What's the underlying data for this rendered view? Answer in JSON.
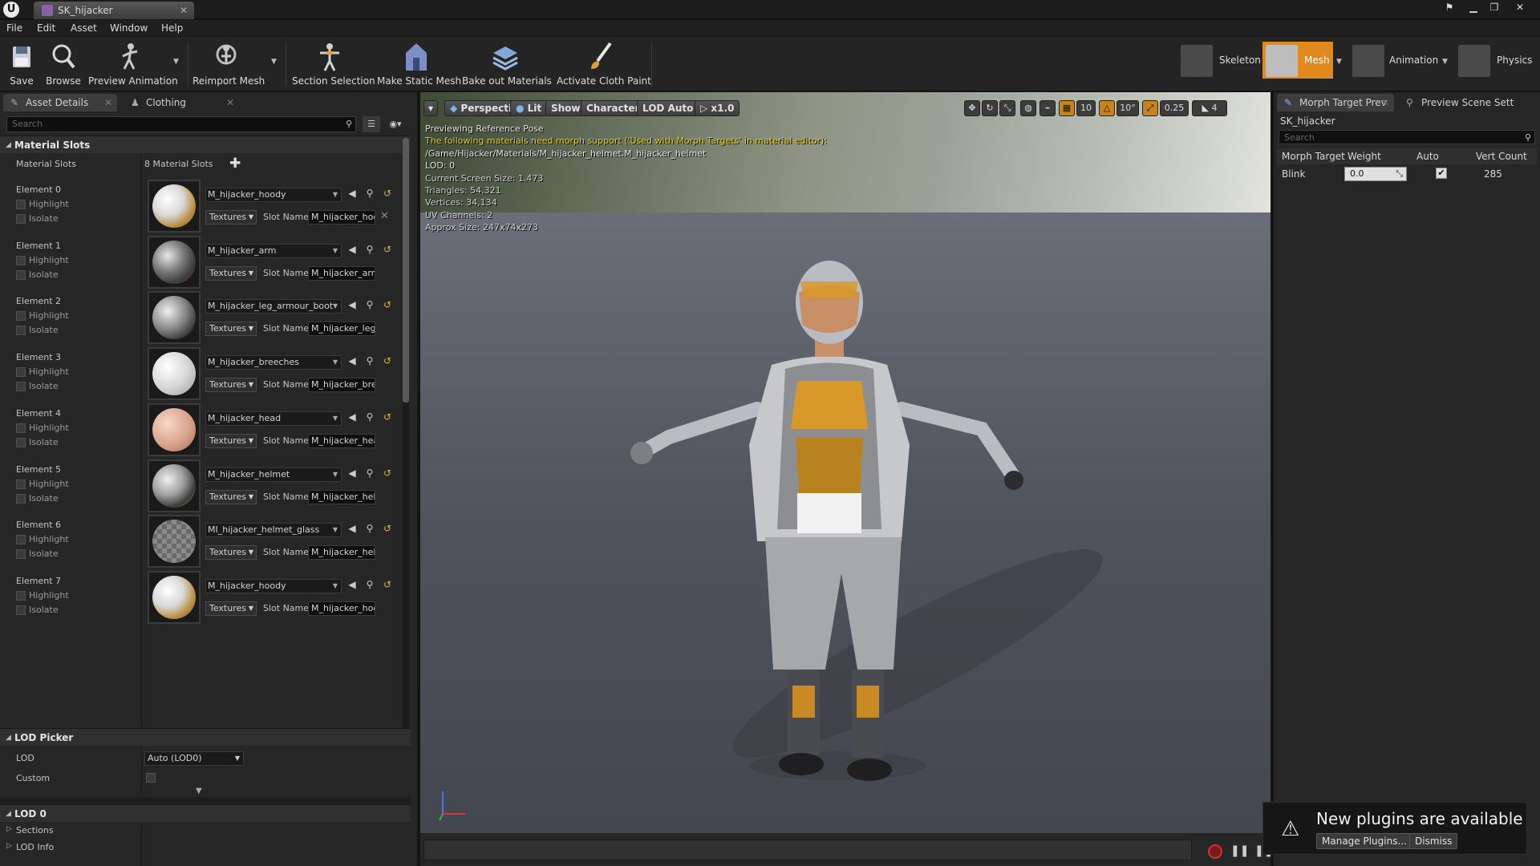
{
  "titlebar": {
    "asset_tab": "SK_hijacker"
  },
  "menu": [
    "File",
    "Edit",
    "Asset",
    "Window",
    "Help"
  ],
  "toolbar": {
    "save": "Save",
    "browse": "Browse",
    "preview_animation": "Preview Animation",
    "reimport_mesh": "Reimport Mesh",
    "section_selection": "Section Selection",
    "make_static_mesh": "Make Static Mesh",
    "bake_out_materials": "Bake out Materials",
    "activate_cloth_paint": "Activate Cloth Paint"
  },
  "modes": {
    "skeleton": "Skeleton",
    "mesh": "Mesh",
    "animation": "Animation",
    "physics": "Physics",
    "active": "Mesh",
    "accent": "#e08a1e"
  },
  "left_panel": {
    "tabs": [
      "Asset Details",
      "Clothing"
    ],
    "search_placeholder": "Search",
    "material_slots_header": "Material Slots",
    "material_slots_label": "Material Slots",
    "material_slots_count": "8 Material Slots",
    "highlight_label": "Highlight",
    "isolate_label": "Isolate",
    "textures_label": "Textures",
    "slot_name_label": "Slot Name",
    "elements": [
      {
        "title": "Element 0",
        "material": "M_hijacker_hoody",
        "slot": "M_hijacker_hoo",
        "thumb": "hoody"
      },
      {
        "title": "Element 1",
        "material": "M_hijacker_arm",
        "slot": "M_hijacker_arr",
        "thumb": "arm"
      },
      {
        "title": "Element 2",
        "material": "M_hijacker_leg_armour_boot",
        "slot": "M_hijacker_leg",
        "thumb": "leg"
      },
      {
        "title": "Element 3",
        "material": "M_hijacker_breeches",
        "slot": "M_hijacker_bre",
        "thumb": "breeches"
      },
      {
        "title": "Element 4",
        "material": "M_hijacker_head",
        "slot": "M_hijacker_hea",
        "thumb": "head"
      },
      {
        "title": "Element 5",
        "material": "M_hijacker_helmet",
        "slot": "M_hijacker_hel",
        "thumb": "helmet"
      },
      {
        "title": "Element 6",
        "material": "MI_hijacker_helmet_glass",
        "slot": "M_hijacker_hel",
        "thumb": "glass"
      },
      {
        "title": "Element 7",
        "material": "M_hijacker_hoody",
        "slot": "M_hijacker_hoo",
        "thumb": "hoody"
      }
    ],
    "lod_picker_header": "LOD Picker",
    "lod_label": "LOD",
    "lod_value": "Auto (LOD0)",
    "custom_label": "Custom",
    "lod0_header": "LOD 0",
    "sections_label": "Sections",
    "lod_info_label": "LOD Info"
  },
  "viewport": {
    "perspective": "Perspective",
    "lit": "Lit",
    "show": "Show",
    "character": "Character",
    "lod_auto": "LOD Auto",
    "speed": "x1.0",
    "grid_snap": "10",
    "rot_snap": "10°",
    "scale_snap": "0.25",
    "cam_speed": "4",
    "info": {
      "line1": "Previewing Reference Pose",
      "warning": "The following materials need morph support ('Used with Morph Targets' in material editor):",
      "path": "/Game/Hijacker/Materials/M_hijacker_helmet.M_hijacker_helmet",
      "lod": "LOD: 0",
      "screen_size": "Current Screen Size: 1.473",
      "triangles": "Triangles: 54,321",
      "vertices": "Vertices: 34,134",
      "uv": "UV Channels: 2",
      "approx": "Approx Size: 247x74x273"
    }
  },
  "right_panel": {
    "tabs": [
      "Morph Target Prev",
      "Preview Scene Sett"
    ],
    "asset_name": "SK_hijacker",
    "search_placeholder": "Search",
    "columns": [
      "Morph Target",
      "Weight",
      "Auto",
      "Vert Count"
    ],
    "row": {
      "name": "Blink",
      "weight": "0.0",
      "auto": true,
      "vert_count": "285"
    }
  },
  "notification": {
    "text": "New plugins are available",
    "manage": "Manage Plugins...",
    "dismiss": "Dismiss"
  }
}
